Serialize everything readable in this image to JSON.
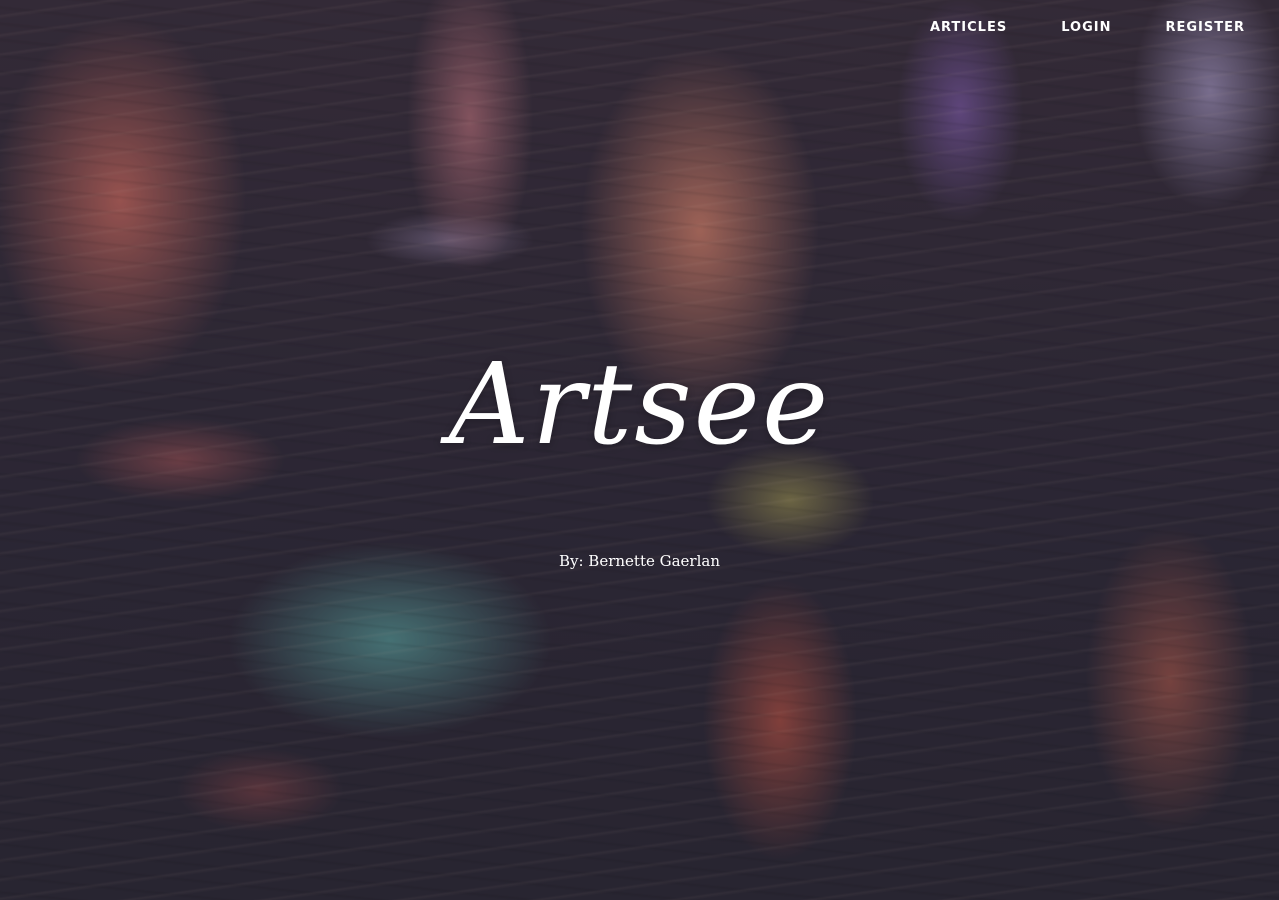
{
  "nav": {
    "items": [
      {
        "label": "ARTICLES"
      },
      {
        "label": "LOGIN"
      },
      {
        "label": "REGISTER"
      }
    ]
  },
  "hero": {
    "title": "Artsee",
    "byline": "By: Bernette Gaerlan",
    "background": "blurred water reflection photo (red, purple, teal tones)"
  },
  "colors": {
    "text": "#ffffff",
    "background_dark": "#2e2a3a"
  }
}
